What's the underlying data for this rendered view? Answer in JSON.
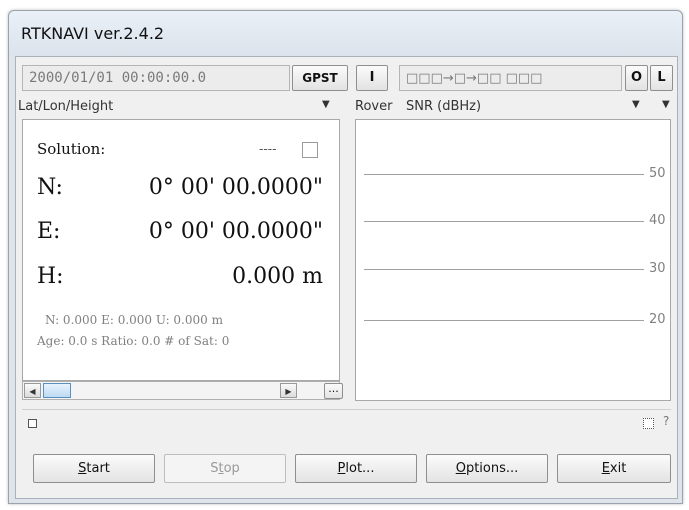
{
  "window": {
    "title": "RTKNAVI ver.2.4.2"
  },
  "toolbar": {
    "time": "2000/01/01 00:00:00.0",
    "gpst_label": "GPST",
    "i_label": "I",
    "stream_status": "□□□→□→□□ □□□",
    "o_label": "O",
    "l_label": "L"
  },
  "left_panel": {
    "format_select": "Lat/Lon/Height",
    "solution_label": "Solution:",
    "solution_value": "----",
    "n_label": "N:",
    "n_value": "0° 00' 00.0000\"",
    "e_label": "E:",
    "e_value": "0° 00' 00.0000\"",
    "h_label": "H:",
    "h_value": "0.000 m",
    "neu_line": "N: 0.000 E: 0.000 U: 0.000 m",
    "age_line": "Age: 0.0 s Ratio: 0.0 # of Sat: 0",
    "more_button": "..."
  },
  "right_panel": {
    "source_select": "Rover",
    "type_select": "SNR (dBHz)",
    "y_ticks": [
      "50",
      "40",
      "30",
      "20"
    ]
  },
  "status_bar": {
    "help": "?"
  },
  "buttons": {
    "start_u": "S",
    "start_rest": "tart",
    "stop_a": "S",
    "stop_u": "t",
    "stop_rest": "op",
    "plot_u": "P",
    "plot_rest": "lot...",
    "options_u": "O",
    "options_rest": "ptions...",
    "exit_u": "E",
    "exit_rest": "xit"
  }
}
